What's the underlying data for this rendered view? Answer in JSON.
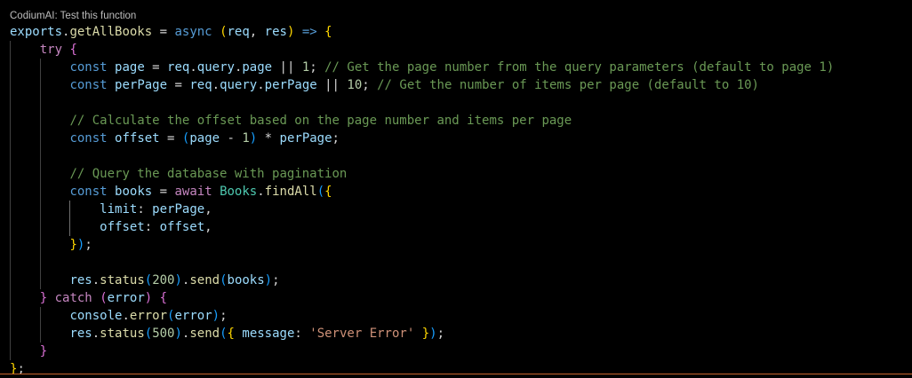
{
  "codelens": {
    "label": "CodiumAI: Test this function"
  },
  "colors": {
    "background": "#000000",
    "identifier": "#9cdcfe",
    "function": "#dcdcaa",
    "keyword_storage": "#569cd6",
    "keyword_control": "#c586c0",
    "class": "#4ec9b0",
    "number": "#b5cea8",
    "string": "#ce9178",
    "comment": "#6a9955",
    "text": "#d4d4d4",
    "bracket_gold": "#ffd700",
    "bracket_purple": "#da70d6",
    "bracket_blue": "#179fff"
  },
  "editor": {
    "lines": [
      {
        "indent": 0,
        "guides": [],
        "tokens": [
          {
            "text": "exports",
            "kind": "identifier"
          },
          {
            "text": ".",
            "kind": "text"
          },
          {
            "text": "getAllBooks",
            "kind": "function"
          },
          {
            "text": " = ",
            "kind": "text"
          },
          {
            "text": "async",
            "kind": "keyword_storage"
          },
          {
            "text": " ",
            "kind": "text"
          },
          {
            "text": "(",
            "kind": "bracket_gold"
          },
          {
            "text": "req",
            "kind": "identifier"
          },
          {
            "text": ", ",
            "kind": "text"
          },
          {
            "text": "res",
            "kind": "identifier"
          },
          {
            "text": ")",
            "kind": "bracket_gold"
          },
          {
            "text": " ",
            "kind": "text"
          },
          {
            "text": "=>",
            "kind": "keyword_storage"
          },
          {
            "text": " ",
            "kind": "text"
          },
          {
            "text": "{",
            "kind": "bracket_gold"
          }
        ]
      },
      {
        "indent": 4,
        "guides": [
          0
        ],
        "tokens": [
          {
            "text": "try",
            "kind": "keyword_control"
          },
          {
            "text": " ",
            "kind": "text"
          },
          {
            "text": "{",
            "kind": "bracket_purple"
          }
        ]
      },
      {
        "indent": 8,
        "guides": [
          0,
          4
        ],
        "tokens": [
          {
            "text": "const",
            "kind": "keyword_storage"
          },
          {
            "text": " ",
            "kind": "text"
          },
          {
            "text": "page",
            "kind": "identifier"
          },
          {
            "text": " = ",
            "kind": "text"
          },
          {
            "text": "req",
            "kind": "identifier"
          },
          {
            "text": ".",
            "kind": "text"
          },
          {
            "text": "query",
            "kind": "identifier"
          },
          {
            "text": ".",
            "kind": "text"
          },
          {
            "text": "page",
            "kind": "identifier"
          },
          {
            "text": " || ",
            "kind": "text"
          },
          {
            "text": "1",
            "kind": "number"
          },
          {
            "text": "; ",
            "kind": "text"
          },
          {
            "text": "// Get the page number from the query parameters (default to page 1)",
            "kind": "comment"
          }
        ]
      },
      {
        "indent": 8,
        "guides": [
          0,
          4
        ],
        "tokens": [
          {
            "text": "const",
            "kind": "keyword_storage"
          },
          {
            "text": " ",
            "kind": "text"
          },
          {
            "text": "perPage",
            "kind": "identifier"
          },
          {
            "text": " = ",
            "kind": "text"
          },
          {
            "text": "req",
            "kind": "identifier"
          },
          {
            "text": ".",
            "kind": "text"
          },
          {
            "text": "query",
            "kind": "identifier"
          },
          {
            "text": ".",
            "kind": "text"
          },
          {
            "text": "perPage",
            "kind": "identifier"
          },
          {
            "text": " || ",
            "kind": "text"
          },
          {
            "text": "10",
            "kind": "number"
          },
          {
            "text": "; ",
            "kind": "text"
          },
          {
            "text": "// Get the number of items per page (default to 10)",
            "kind": "comment"
          }
        ]
      },
      {
        "indent": 0,
        "guides": [
          0,
          4
        ],
        "tokens": []
      },
      {
        "indent": 8,
        "guides": [
          0,
          4
        ],
        "tokens": [
          {
            "text": "// Calculate the offset based on the page number and items per page",
            "kind": "comment"
          }
        ]
      },
      {
        "indent": 8,
        "guides": [
          0,
          4
        ],
        "tokens": [
          {
            "text": "const",
            "kind": "keyword_storage"
          },
          {
            "text": " ",
            "kind": "text"
          },
          {
            "text": "offset",
            "kind": "identifier"
          },
          {
            "text": " = ",
            "kind": "text"
          },
          {
            "text": "(",
            "kind": "bracket_blue"
          },
          {
            "text": "page",
            "kind": "identifier"
          },
          {
            "text": " - ",
            "kind": "text"
          },
          {
            "text": "1",
            "kind": "number"
          },
          {
            "text": ")",
            "kind": "bracket_blue"
          },
          {
            "text": " * ",
            "kind": "text"
          },
          {
            "text": "perPage",
            "kind": "identifier"
          },
          {
            "text": ";",
            "kind": "text"
          }
        ]
      },
      {
        "indent": 0,
        "guides": [
          0,
          4
        ],
        "tokens": []
      },
      {
        "indent": 8,
        "guides": [
          0,
          4
        ],
        "tokens": [
          {
            "text": "// Query the database with pagination",
            "kind": "comment"
          }
        ]
      },
      {
        "indent": 8,
        "guides": [
          0,
          4
        ],
        "tokens": [
          {
            "text": "const",
            "kind": "keyword_storage"
          },
          {
            "text": " ",
            "kind": "text"
          },
          {
            "text": "books",
            "kind": "identifier"
          },
          {
            "text": " = ",
            "kind": "text"
          },
          {
            "text": "await",
            "kind": "keyword_control"
          },
          {
            "text": " ",
            "kind": "text"
          },
          {
            "text": "Books",
            "kind": "class"
          },
          {
            "text": ".",
            "kind": "text"
          },
          {
            "text": "findAll",
            "kind": "function"
          },
          {
            "text": "(",
            "kind": "bracket_blue"
          },
          {
            "text": "{",
            "kind": "bracket_gold"
          }
        ]
      },
      {
        "indent": 12,
        "guides": [
          0,
          4,
          8
        ],
        "active_guide": 8,
        "tokens": [
          {
            "text": "limit",
            "kind": "identifier"
          },
          {
            "text": ": ",
            "kind": "text"
          },
          {
            "text": "perPage",
            "kind": "identifier"
          },
          {
            "text": ",",
            "kind": "text"
          }
        ]
      },
      {
        "indent": 12,
        "guides": [
          0,
          4,
          8
        ],
        "active_guide": 8,
        "tokens": [
          {
            "text": "offset",
            "kind": "identifier"
          },
          {
            "text": ": ",
            "kind": "text"
          },
          {
            "text": "offset",
            "kind": "identifier"
          },
          {
            "text": ",",
            "kind": "text"
          }
        ]
      },
      {
        "indent": 8,
        "guides": [
          0,
          4
        ],
        "tokens": [
          {
            "text": "}",
            "kind": "bracket_gold"
          },
          {
            "text": ")",
            "kind": "bracket_blue"
          },
          {
            "text": ";",
            "kind": "text"
          }
        ]
      },
      {
        "indent": 0,
        "guides": [
          0,
          4
        ],
        "tokens": []
      },
      {
        "indent": 8,
        "guides": [
          0,
          4
        ],
        "tokens": [
          {
            "text": "res",
            "kind": "identifier"
          },
          {
            "text": ".",
            "kind": "text"
          },
          {
            "text": "status",
            "kind": "function"
          },
          {
            "text": "(",
            "kind": "bracket_blue"
          },
          {
            "text": "200",
            "kind": "number"
          },
          {
            "text": ")",
            "kind": "bracket_blue"
          },
          {
            "text": ".",
            "kind": "text"
          },
          {
            "text": "send",
            "kind": "function"
          },
          {
            "text": "(",
            "kind": "bracket_blue"
          },
          {
            "text": "books",
            "kind": "identifier"
          },
          {
            "text": ")",
            "kind": "bracket_blue"
          },
          {
            "text": ";",
            "kind": "text"
          }
        ]
      },
      {
        "indent": 4,
        "guides": [
          0
        ],
        "tokens": [
          {
            "text": "}",
            "kind": "bracket_purple"
          },
          {
            "text": " ",
            "kind": "text"
          },
          {
            "text": "catch",
            "kind": "keyword_control"
          },
          {
            "text": " ",
            "kind": "text"
          },
          {
            "text": "(",
            "kind": "bracket_purple"
          },
          {
            "text": "error",
            "kind": "identifier"
          },
          {
            "text": ")",
            "kind": "bracket_purple"
          },
          {
            "text": " ",
            "kind": "text"
          },
          {
            "text": "{",
            "kind": "bracket_purple"
          }
        ]
      },
      {
        "indent": 8,
        "guides": [
          0,
          4
        ],
        "tokens": [
          {
            "text": "console",
            "kind": "identifier"
          },
          {
            "text": ".",
            "kind": "text"
          },
          {
            "text": "error",
            "kind": "function"
          },
          {
            "text": "(",
            "kind": "bracket_blue"
          },
          {
            "text": "error",
            "kind": "identifier"
          },
          {
            "text": ")",
            "kind": "bracket_blue"
          },
          {
            "text": ";",
            "kind": "text"
          }
        ]
      },
      {
        "indent": 8,
        "guides": [
          0,
          4
        ],
        "tokens": [
          {
            "text": "res",
            "kind": "identifier"
          },
          {
            "text": ".",
            "kind": "text"
          },
          {
            "text": "status",
            "kind": "function"
          },
          {
            "text": "(",
            "kind": "bracket_blue"
          },
          {
            "text": "500",
            "kind": "number"
          },
          {
            "text": ")",
            "kind": "bracket_blue"
          },
          {
            "text": ".",
            "kind": "text"
          },
          {
            "text": "send",
            "kind": "function"
          },
          {
            "text": "(",
            "kind": "bracket_blue"
          },
          {
            "text": "{",
            "kind": "bracket_gold"
          },
          {
            "text": " ",
            "kind": "text"
          },
          {
            "text": "message",
            "kind": "identifier"
          },
          {
            "text": ": ",
            "kind": "text"
          },
          {
            "text": "'Server Error'",
            "kind": "string"
          },
          {
            "text": " ",
            "kind": "text"
          },
          {
            "text": "}",
            "kind": "bracket_gold"
          },
          {
            "text": ")",
            "kind": "bracket_blue"
          },
          {
            "text": ";",
            "kind": "text"
          }
        ]
      },
      {
        "indent": 4,
        "guides": [
          0
        ],
        "tokens": [
          {
            "text": "}",
            "kind": "bracket_purple"
          }
        ]
      },
      {
        "indent": 0,
        "guides": [],
        "tokens": [
          {
            "text": "}",
            "kind": "bracket_gold"
          },
          {
            "text": ";",
            "kind": "text"
          }
        ]
      }
    ]
  }
}
